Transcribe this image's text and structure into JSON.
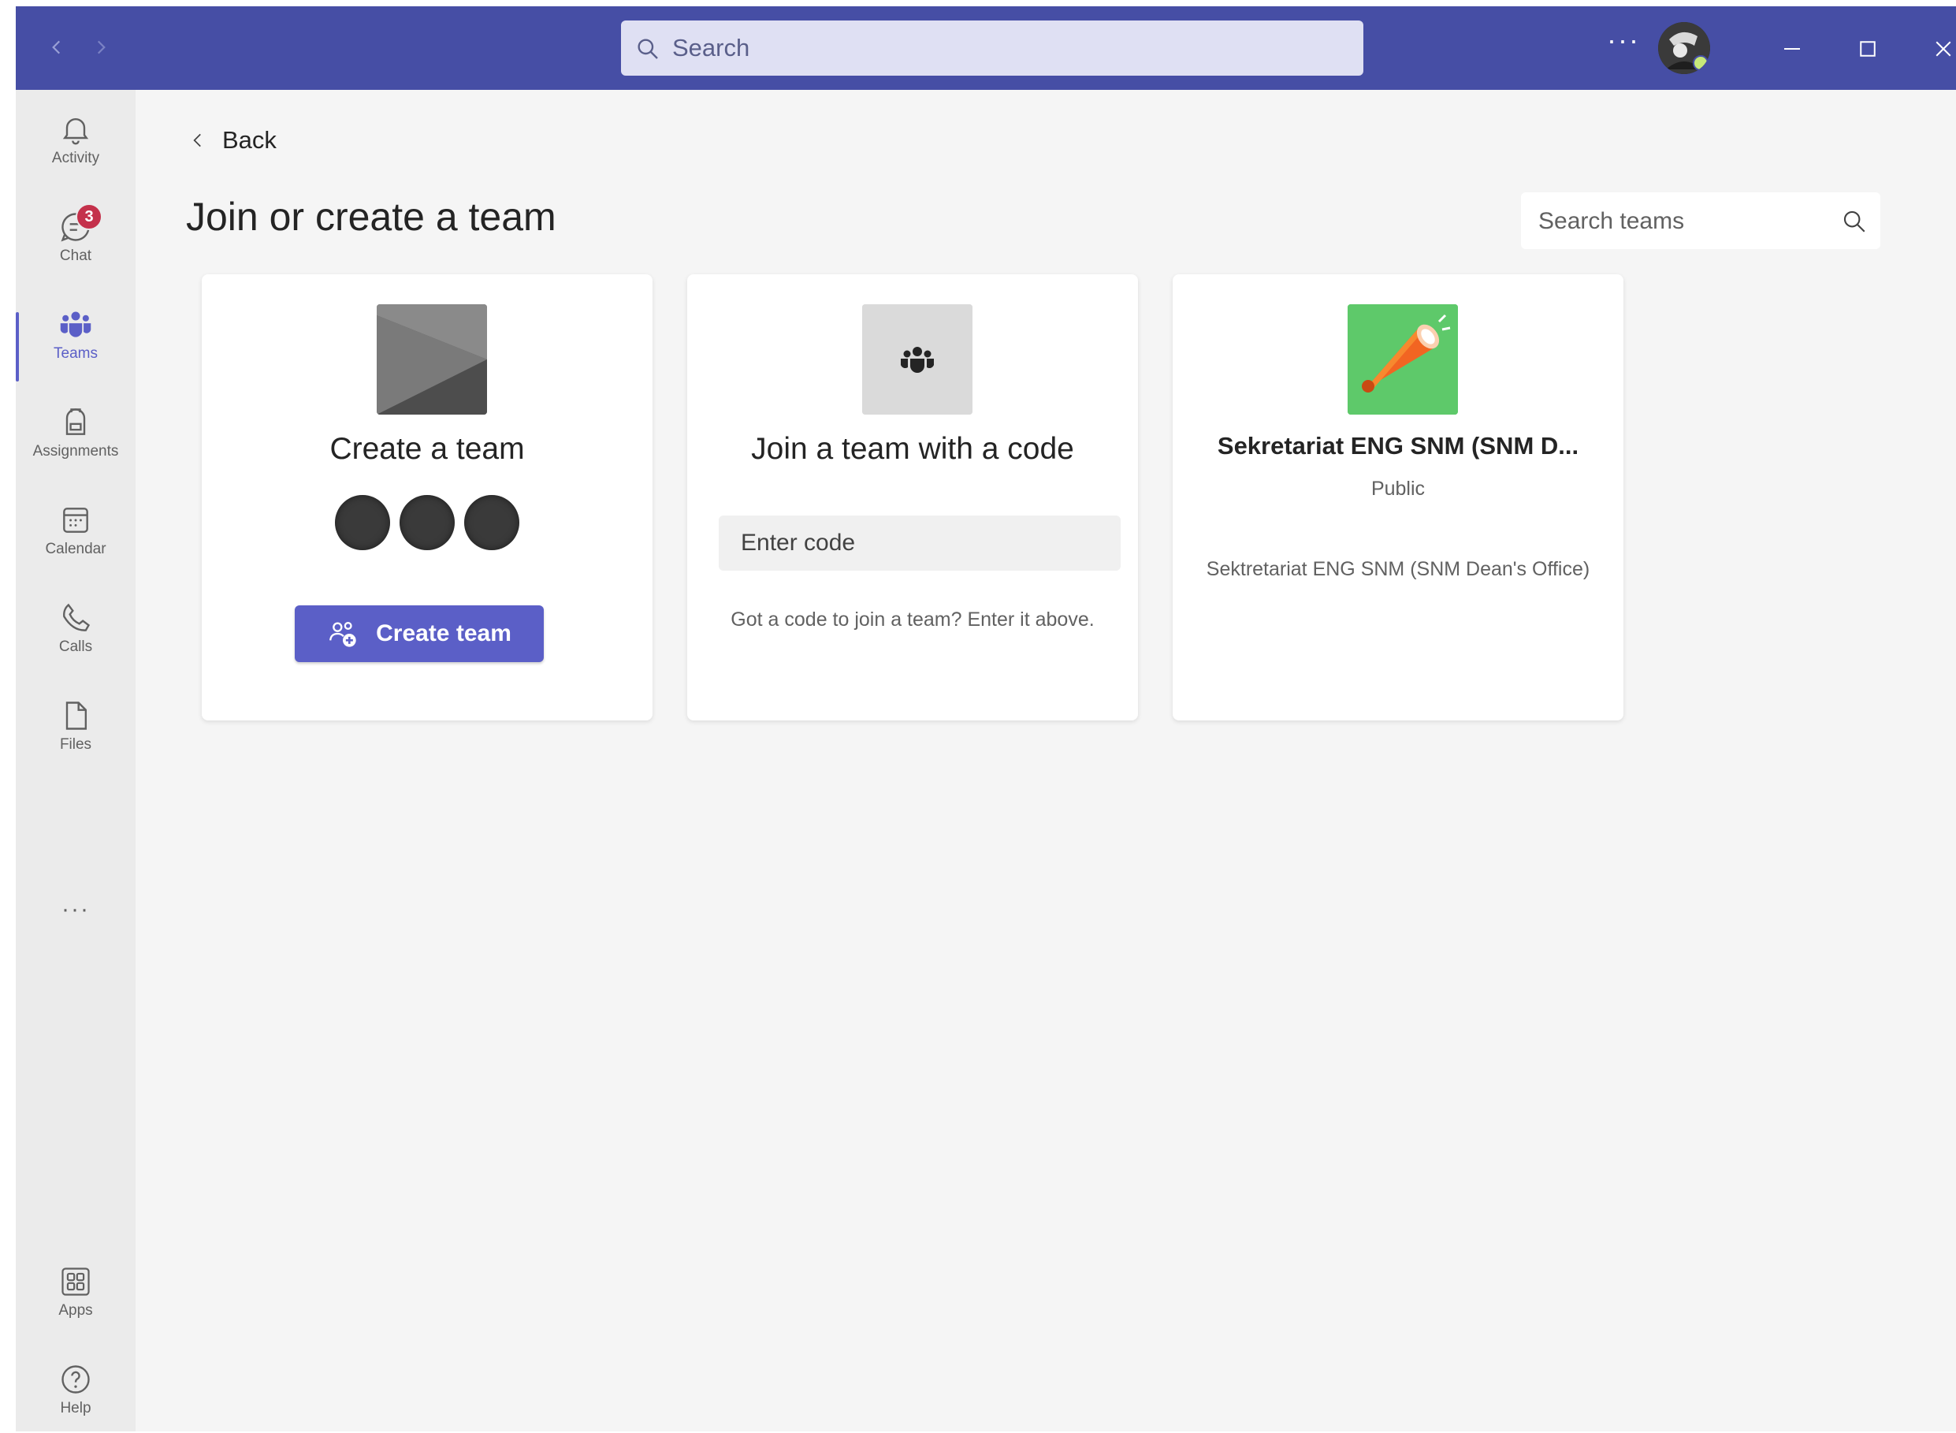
{
  "titlebar": {
    "search_placeholder": "Search",
    "more_label": "···"
  },
  "rail": {
    "items": [
      {
        "label": "Activity",
        "icon": "bell-icon"
      },
      {
        "label": "Chat",
        "icon": "chat-icon",
        "badge": "3"
      },
      {
        "label": "Teams",
        "icon": "teams-icon",
        "active": true
      },
      {
        "label": "Assignments",
        "icon": "backpack-icon"
      },
      {
        "label": "Calendar",
        "icon": "calendar-icon"
      },
      {
        "label": "Calls",
        "icon": "phone-icon"
      },
      {
        "label": "Files",
        "icon": "file-icon"
      }
    ],
    "more_label": "···",
    "bottom_items": [
      {
        "label": "Apps",
        "icon": "apps-icon"
      },
      {
        "label": "Help",
        "icon": "help-icon"
      }
    ]
  },
  "main": {
    "back_label": "Back",
    "title": "Join or create a team",
    "search_placeholder": "Search teams",
    "cards": {
      "create": {
        "title": "Create a team",
        "button_label": "Create team"
      },
      "join": {
        "title": "Join a team with a code",
        "input_placeholder": "Enter code",
        "hint": "Got a code to join a team? Enter it above."
      },
      "team": {
        "name": "Sekretariat ENG SNM (SNM D...",
        "privacy": "Public",
        "description": "Sektretariat ENG SNM (SNM Dean's Office)"
      }
    }
  },
  "colors": {
    "titlebar": "#464ea5",
    "accent": "#5b5fc7",
    "badge": "#c4314b",
    "team_tile": "#5ec96a"
  }
}
